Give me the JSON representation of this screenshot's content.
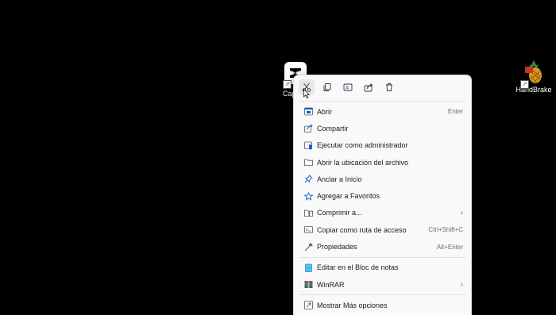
{
  "desktop": {
    "icons": [
      {
        "label": "Cap",
        "icon": "capcut-icon"
      },
      {
        "label": "HandBrake",
        "icon": "handbrake-pineapple-icon"
      }
    ]
  },
  "context_menu": {
    "quick_actions": [
      {
        "name": "cut",
        "icon": "scissors-icon"
      },
      {
        "name": "copy",
        "icon": "copy-icon"
      },
      {
        "name": "rename",
        "icon": "rename-icon"
      },
      {
        "name": "share",
        "icon": "share-icon"
      },
      {
        "name": "delete",
        "icon": "trash-icon"
      }
    ],
    "items": [
      {
        "label": "Abrir",
        "shortcut": "Enter",
        "icon": "open-icon"
      },
      {
        "label": "Compartir",
        "shortcut": "",
        "icon": "share-icon"
      },
      {
        "label": "Ejecutar como administrador",
        "shortcut": "",
        "icon": "shield-icon"
      },
      {
        "label": "Abrir la ubicación del archivo",
        "shortcut": "",
        "icon": "folder-icon"
      },
      {
        "label": "Anclar a Inicio",
        "shortcut": "",
        "icon": "pin-icon"
      },
      {
        "label": "Agregar a Favoritos",
        "shortcut": "",
        "icon": "star-icon"
      },
      {
        "label": "Comprimir a...",
        "shortcut": "",
        "icon": "zip-folder-icon",
        "submenu": true
      },
      {
        "label": "Copiar como ruta de acceso",
        "shortcut": "Ctrl+Shift+C",
        "icon": "path-icon"
      },
      {
        "label": "Propiedades",
        "shortcut": "Alt+Enter",
        "icon": "wrench-icon"
      },
      {
        "label": "Editar en el Bloc de notas",
        "shortcut": "",
        "icon": "notepad-icon"
      },
      {
        "label": "WinRAR",
        "shortcut": "",
        "icon": "winrar-icon",
        "submenu": true
      },
      {
        "label": "Mostrar Más opciones",
        "shortcut": "",
        "icon": "more-options-icon"
      }
    ],
    "chevron": "›"
  },
  "colors": {
    "menu_bg": "#f9f9f9",
    "accent_blue": "#0a5fd6",
    "text": "#1a1a1a",
    "muted": "#6d6d6d"
  }
}
